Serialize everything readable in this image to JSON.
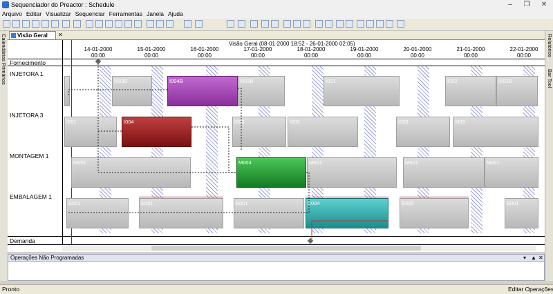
{
  "window": {
    "title": "Sequenciador do Preactor : Schedule"
  },
  "menu": [
    "Arquivo",
    "Editar",
    "Visualizar",
    "Sequenciar",
    "Ferramentas",
    "Janela",
    "Ajuda"
  ],
  "doc_tab": {
    "label": "Visão Geral"
  },
  "side_panels": {
    "left": "Calendários Primários",
    "right_1": "Relatórios",
    "right_2": "Bar Tool"
  },
  "chart_header": {
    "title": "Visão Geral   (08-01-2000 18:52 - 26-01-2000 02:05)"
  },
  "days": [
    {
      "date": "14-01-2000",
      "time": "00:00"
    },
    {
      "date": "15-01-2000",
      "time": "00:00"
    },
    {
      "date": "16-01-2000",
      "time": "00:00"
    },
    {
      "date": "17-01-2000",
      "time": "00:00"
    },
    {
      "date": "18-01-2000",
      "time": "00:00"
    },
    {
      "date": "19-01-2000",
      "time": "00:00"
    },
    {
      "date": "20-01-2000",
      "time": "00:00"
    },
    {
      "date": "21-01-2000",
      "time": "00:00"
    },
    {
      "date": "22-01-2000",
      "time": "00:00"
    }
  ],
  "rows": {
    "supply": "Fornecimento",
    "demand": "Demanda",
    "resources": [
      "INJETORA 1",
      "INJETORA 3",
      "MONTAGEM 1",
      "EMBALAGEM 1"
    ]
  },
  "bars": {
    "i1_focus": "I004B",
    "i3_focus": "I004",
    "m1_focus": "M004",
    "e1_focus": "E004",
    "i1_a": "I003B",
    "i1_b": "I001",
    "i1_c": "I002",
    "i1_d": "I003B",
    "i3_a": "I001",
    "i3_b": "I003",
    "i3_c": "I003",
    "m1_a": "M001",
    "m1_b": "M001",
    "m1_c": "M001",
    "m1_d": "M001",
    "e1_a": "E001",
    "e1_b": "E001",
    "e1_c": "E001",
    "e1_d": "E003"
  },
  "colors": {
    "i1_focus": "#a43fb5",
    "i3_focus": "#9b1c1c",
    "m1_focus": "#1f9a2f",
    "e1_focus": "#2aa5a5"
  },
  "bottom_panel": {
    "title": "Operações Não Programadas"
  },
  "status": {
    "left": "Pronto",
    "right": "Editar Operações"
  }
}
